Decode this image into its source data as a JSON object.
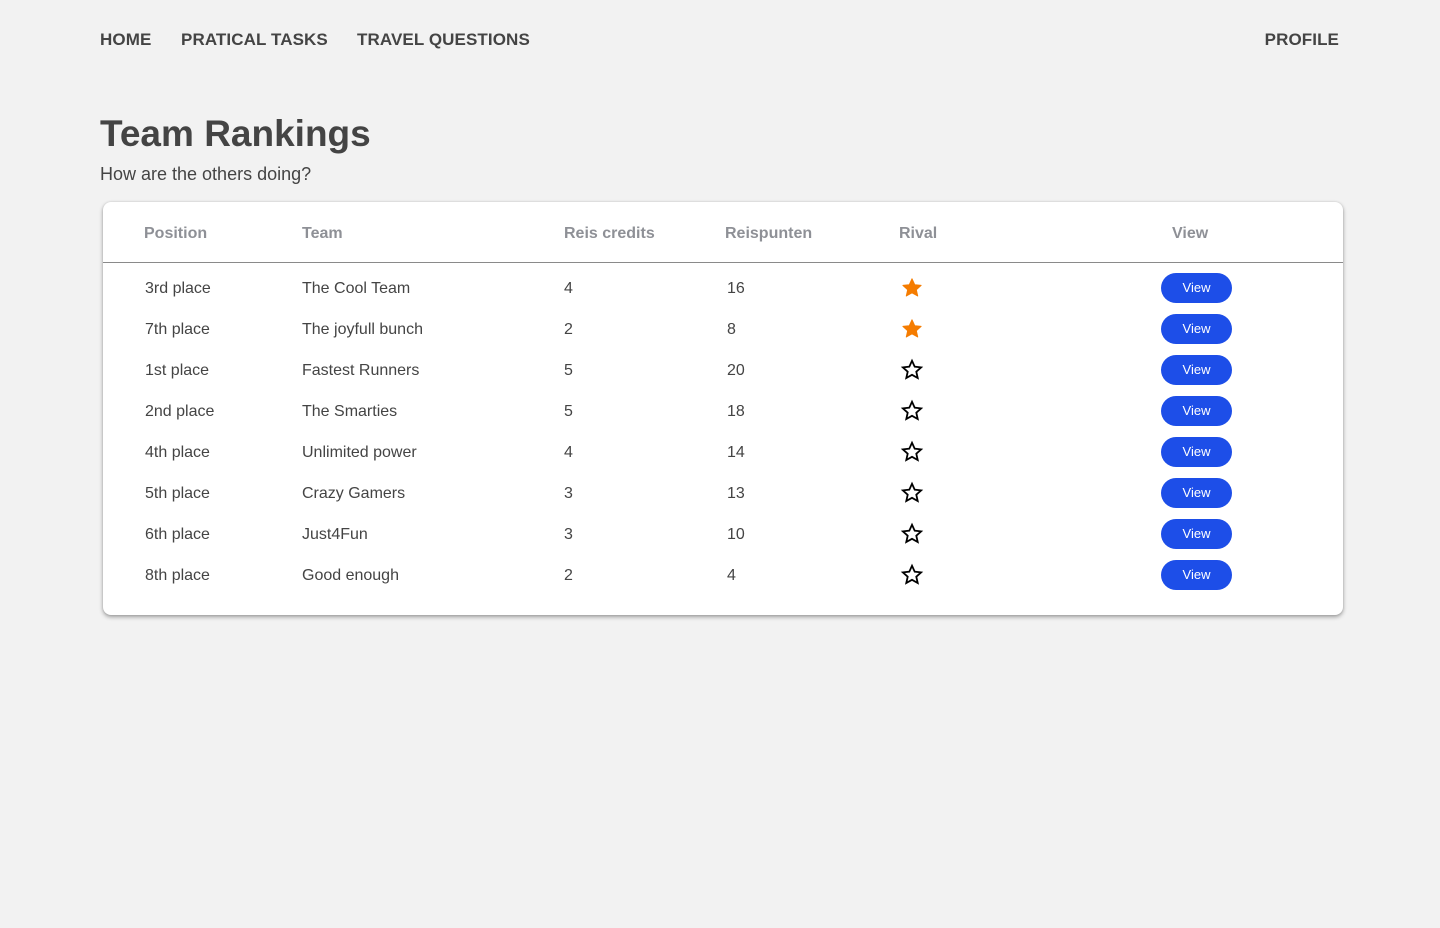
{
  "nav": {
    "home": "HOME",
    "tasks": "PRATICAL TASKS",
    "travel": "TRAVEL QUESTIONS",
    "profile": "PROFILE"
  },
  "header": {
    "title": "Team Rankings",
    "subtitle": "How are the others doing?"
  },
  "table": {
    "columns": {
      "position": "Position",
      "team": "Team",
      "credits": "Reis credits",
      "points": "Reispunten",
      "rival": "Rival",
      "view": "View"
    },
    "rows": [
      {
        "position": "3rd place",
        "team": "The Cool Team",
        "credits": "4",
        "points": "16",
        "rival": true,
        "view_label": "View"
      },
      {
        "position": "7th place",
        "team": "The joyfull bunch",
        "credits": "2",
        "points": "8",
        "rival": true,
        "view_label": "View"
      },
      {
        "position": "1st place",
        "team": "Fastest Runners",
        "credits": "5",
        "points": "20",
        "rival": false,
        "view_label": "View"
      },
      {
        "position": "2nd place",
        "team": "The Smarties",
        "credits": "5",
        "points": "18",
        "rival": false,
        "view_label": "View"
      },
      {
        "position": "4th place",
        "team": "Unlimited power",
        "credits": "4",
        "points": "14",
        "rival": false,
        "view_label": "View"
      },
      {
        "position": "5th place",
        "team": "Crazy Gamers",
        "credits": "3",
        "points": "13",
        "rival": false,
        "view_label": "View"
      },
      {
        "position": "6th place",
        "team": "Just4Fun",
        "credits": "3",
        "points": "10",
        "rival": false,
        "view_label": "View"
      },
      {
        "position": "8th place",
        "team": "Good enough",
        "credits": "2",
        "points": "4",
        "rival": false,
        "view_label": "View"
      }
    ]
  },
  "icons": {
    "rival_on": "star-filled-icon",
    "rival_off": "star-outline-icon"
  },
  "colors": {
    "star_filled": "#f57c00",
    "star_outline": "#000000",
    "button_bg": "#1d4ee8",
    "button_text": "#ffffff",
    "header_text": "#8e9096",
    "body_text": "#444444",
    "page_bg": "#f2f2f2"
  }
}
